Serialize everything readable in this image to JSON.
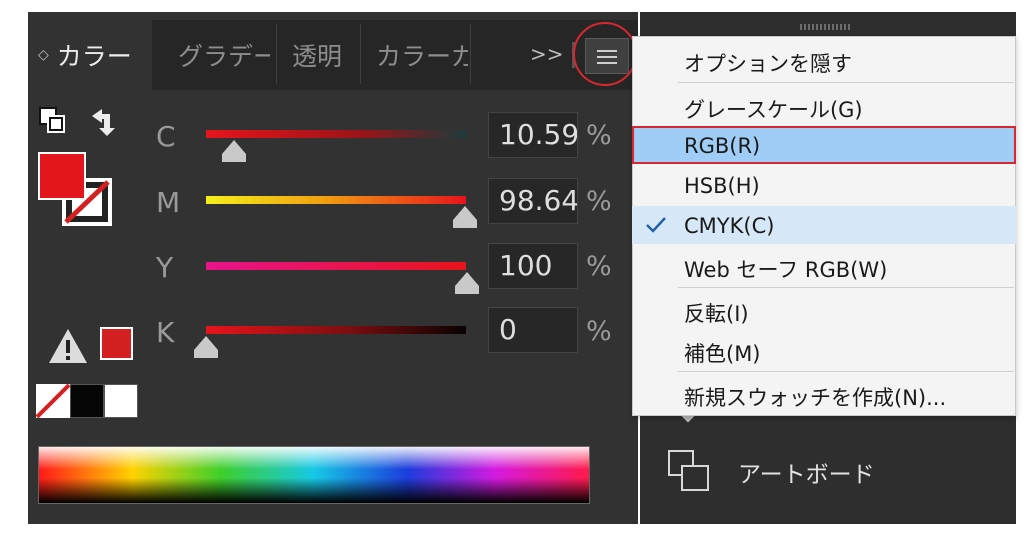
{
  "tabs": {
    "color": "カラー",
    "gradient": "グラデー",
    "transparency": "透明",
    "color_guide": "カラーガ",
    "overflow": ">>"
  },
  "sliders": [
    {
      "label": "C",
      "value": "10.59",
      "percent": 10.59,
      "pct": "%"
    },
    {
      "label": "M",
      "value": "98.64",
      "percent": 98.64,
      "pct": "%"
    },
    {
      "label": "Y",
      "value": "100",
      "percent": 100,
      "pct": "%"
    },
    {
      "label": "K",
      "value": "0",
      "percent": 0,
      "pct": "%"
    }
  ],
  "colors": {
    "fill": "#e3161e",
    "out_of_gamut": "#d42020",
    "panel": "#323232",
    "highlight": "#9fcdf5",
    "highlight_border": "#d8282f"
  },
  "menu": {
    "items": [
      {
        "label": "オプションを隠す"
      },
      {
        "label": "グレースケール(G)"
      },
      {
        "label": "RGB(R)",
        "highlighted": true
      },
      {
        "label": "HSB(H)"
      },
      {
        "label": "CMYK(C)",
        "checked": true
      },
      {
        "label": "Web セーフ RGB(W)"
      },
      {
        "label": "反転(I)"
      },
      {
        "label": "補色(M)"
      },
      {
        "label": "新規スウォッチを作成(N)..."
      }
    ]
  },
  "right_panel": {
    "artboard_label": "アートボード"
  }
}
